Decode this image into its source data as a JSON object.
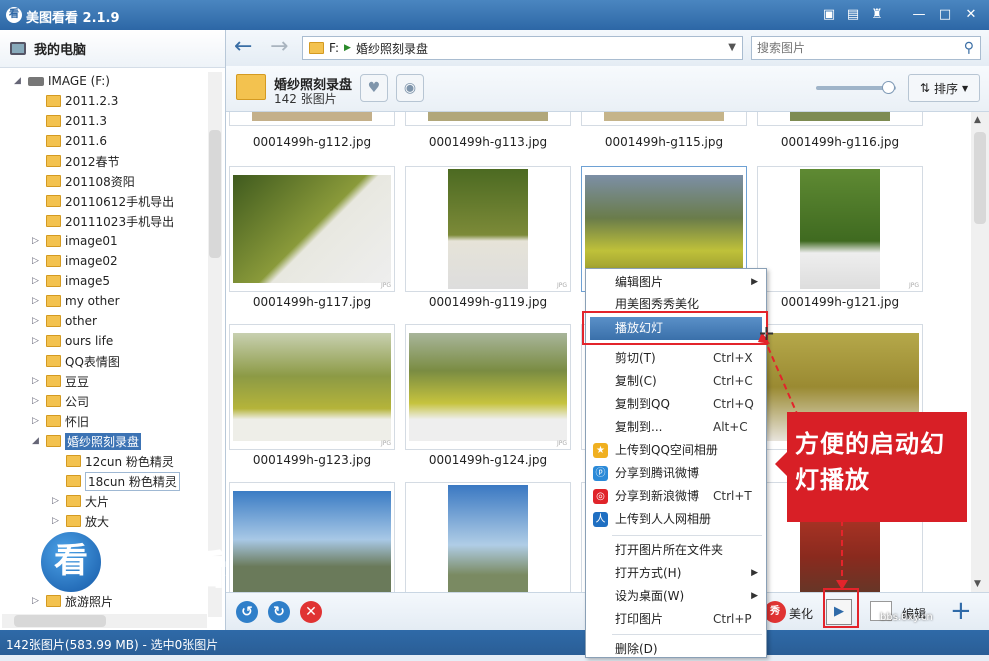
{
  "window": {
    "title": "美图看看 2.1.9",
    "app_icon_text": "看"
  },
  "titlebar_buttons": [
    {
      "name": "feedback-icon",
      "glyph": "▣"
    },
    {
      "name": "menu-icon",
      "glyph": "▤"
    },
    {
      "name": "skin-icon",
      "glyph": "♜"
    },
    {
      "name": "minimize-icon",
      "glyph": "—"
    },
    {
      "name": "maximize-icon",
      "glyph": "□"
    },
    {
      "name": "close-icon",
      "glyph": "✕"
    }
  ],
  "sidebar": {
    "header": "我的电脑",
    "drive": "IMAGE (F:)",
    "items": [
      {
        "label": "2011.2.3"
      },
      {
        "label": "2011.3"
      },
      {
        "label": "2011.6"
      },
      {
        "label": "2012春节"
      },
      {
        "label": "201108资阳"
      },
      {
        "label": "20110612手机导出"
      },
      {
        "label": "20111023手机导出"
      },
      {
        "label": "image01"
      },
      {
        "label": "image02"
      },
      {
        "label": "image5"
      },
      {
        "label": "my other"
      },
      {
        "label": "other"
      },
      {
        "label": "ours life"
      },
      {
        "label": "QQ表情图"
      },
      {
        "label": "豆豆"
      },
      {
        "label": "公司"
      },
      {
        "label": "怀旧"
      },
      {
        "label": "婚纱照刻录盘"
      },
      {
        "label": "12cun 粉色精灵"
      },
      {
        "label": "18cun 粉色精灵"
      },
      {
        "label": "大片"
      },
      {
        "label": "放大"
      },
      {
        "label": "旅游照片"
      }
    ]
  },
  "logo_text": "美图看看",
  "nav": {
    "back_glyph": "←",
    "forward_glyph": "→",
    "address_drive": "F:",
    "address_folder": "婚纱照刻录盘",
    "search_placeholder": "搜索图片"
  },
  "folder_info": {
    "name": "婚纱照刻录盘",
    "count": "142 张图片",
    "sort_label": "排序"
  },
  "thumbnails": [
    {
      "caption": "0001499h-g112.jpg"
    },
    {
      "caption": "0001499h-g113.jpg"
    },
    {
      "caption": "0001499h-g115.jpg"
    },
    {
      "caption": "0001499h-g116.jpg"
    },
    {
      "caption": "0001499h-g117.jpg"
    },
    {
      "caption": "0001499h-g119.jpg"
    },
    {
      "caption": ""
    },
    {
      "caption": "0001499h-g121.jpg"
    },
    {
      "caption": "0001499h-g123.jpg"
    },
    {
      "caption": "0001499h-g124.jpg"
    },
    {
      "caption": ""
    },
    {
      "caption": ""
    }
  ],
  "context_menu": [
    {
      "label": "编辑图片",
      "shortcut": "",
      "submenu": true
    },
    {
      "label": "用美图秀秀美化",
      "shortcut": ""
    },
    {
      "label": "播放幻灯",
      "shortcut": "",
      "active": true
    },
    {
      "label": "剪切(T)",
      "shortcut": "Ctrl+X"
    },
    {
      "label": "复制(C)",
      "shortcut": "Ctrl+C"
    },
    {
      "label": "复制到QQ",
      "shortcut": "Ctrl+Q"
    },
    {
      "label": "复制到...",
      "shortcut": "Alt+C"
    },
    {
      "label": "上传到QQ空间相册",
      "shortcut": ""
    },
    {
      "label": "分享到腾讯微博",
      "shortcut": ""
    },
    {
      "label": "分享到新浪微博",
      "shortcut": "Ctrl+T"
    },
    {
      "label": "上传到人人网相册",
      "shortcut": ""
    },
    {
      "label": "打开图片所在文件夹",
      "shortcut": ""
    },
    {
      "label": "打开方式(H)",
      "shortcut": "",
      "submenu": true
    },
    {
      "label": "设为桌面(W)",
      "shortcut": "",
      "submenu": true
    },
    {
      "label": "打印图片",
      "shortcut": "Ctrl+P"
    },
    {
      "label": "删除(D)",
      "shortcut": ""
    }
  ],
  "bottom_bar": {
    "beautify_label": "美化",
    "edit_label": "编辑"
  },
  "status": "142张图片(583.99 MB) - 选中0张图片",
  "callout": "方便的启动幻灯播放",
  "watermark": "bbs.0xy.cn"
}
